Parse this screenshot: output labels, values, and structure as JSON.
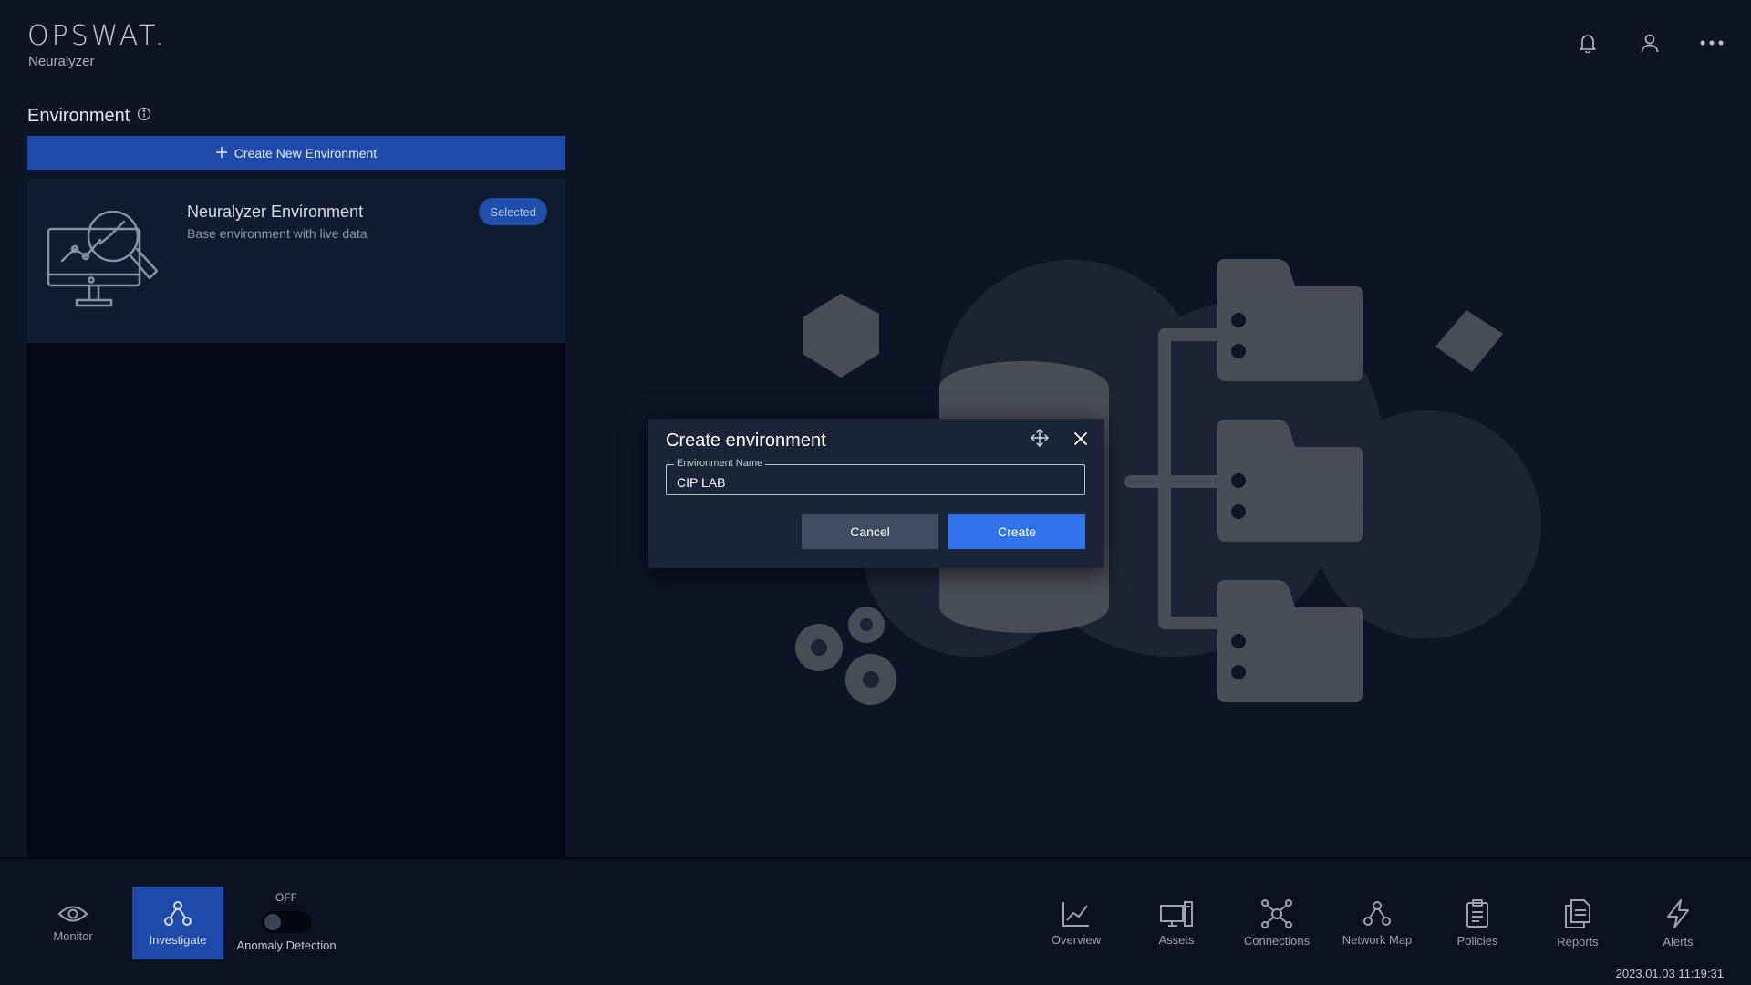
{
  "header": {
    "brand": "OPSWAT.",
    "product": "Neuralyzer",
    "icons": [
      "bell-icon",
      "user-icon",
      "more-icon"
    ]
  },
  "environment": {
    "title": "Environment",
    "create_button": "Create New Environment",
    "cards": [
      {
        "name": "Neuralyzer Environment",
        "description": "Base environment with live data",
        "badge": "Selected"
      }
    ]
  },
  "modal": {
    "title": "Create environment",
    "field_label": "Environment Name",
    "field_value": "CIP LAB",
    "cancel_label": "Cancel",
    "create_label": "Create"
  },
  "bottom_nav": {
    "left": [
      {
        "label": "Monitor",
        "icon": "eye-icon"
      },
      {
        "label": "Investigate",
        "icon": "investigate-icon",
        "active": true
      }
    ],
    "anomaly": {
      "state": "OFF",
      "label": "Anomaly Detection"
    },
    "right": [
      {
        "label": "Overview",
        "icon": "chart-icon"
      },
      {
        "label": "Assets",
        "icon": "assets-icon"
      },
      {
        "label": "Connections",
        "icon": "connections-icon"
      },
      {
        "label": "Network Map",
        "icon": "network-map-icon"
      },
      {
        "label": "Policies",
        "icon": "clipboard-icon"
      },
      {
        "label": "Reports",
        "icon": "reports-icon"
      },
      {
        "label": "Alerts",
        "icon": "bolt-icon"
      }
    ],
    "timestamp": "2023.01.03 11:19:31"
  },
  "colors": {
    "background": "#0d1426",
    "accent": "#1e4bab",
    "primary_button": "#2f72ea",
    "secondary_button": "#3f4a63"
  }
}
